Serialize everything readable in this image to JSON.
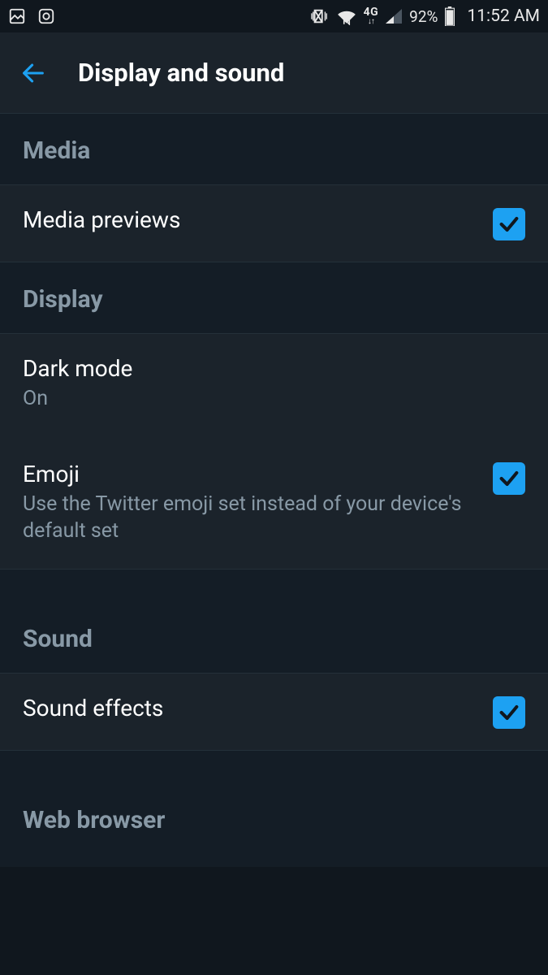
{
  "statusbar": {
    "battery_percent": "92%",
    "clock": "11:52 AM"
  },
  "appbar": {
    "title": "Display and sound"
  },
  "sections": {
    "media": {
      "header": "Media",
      "previews_label": "Media previews"
    },
    "display": {
      "header": "Display",
      "darkmode_label": "Dark mode",
      "darkmode_value": "On",
      "emoji_label": "Emoji",
      "emoji_desc": "Use the Twitter emoji set instead of your device's default set"
    },
    "sound": {
      "header": "Sound",
      "effects_label": "Sound effects"
    },
    "web": {
      "header": "Web browser"
    }
  }
}
